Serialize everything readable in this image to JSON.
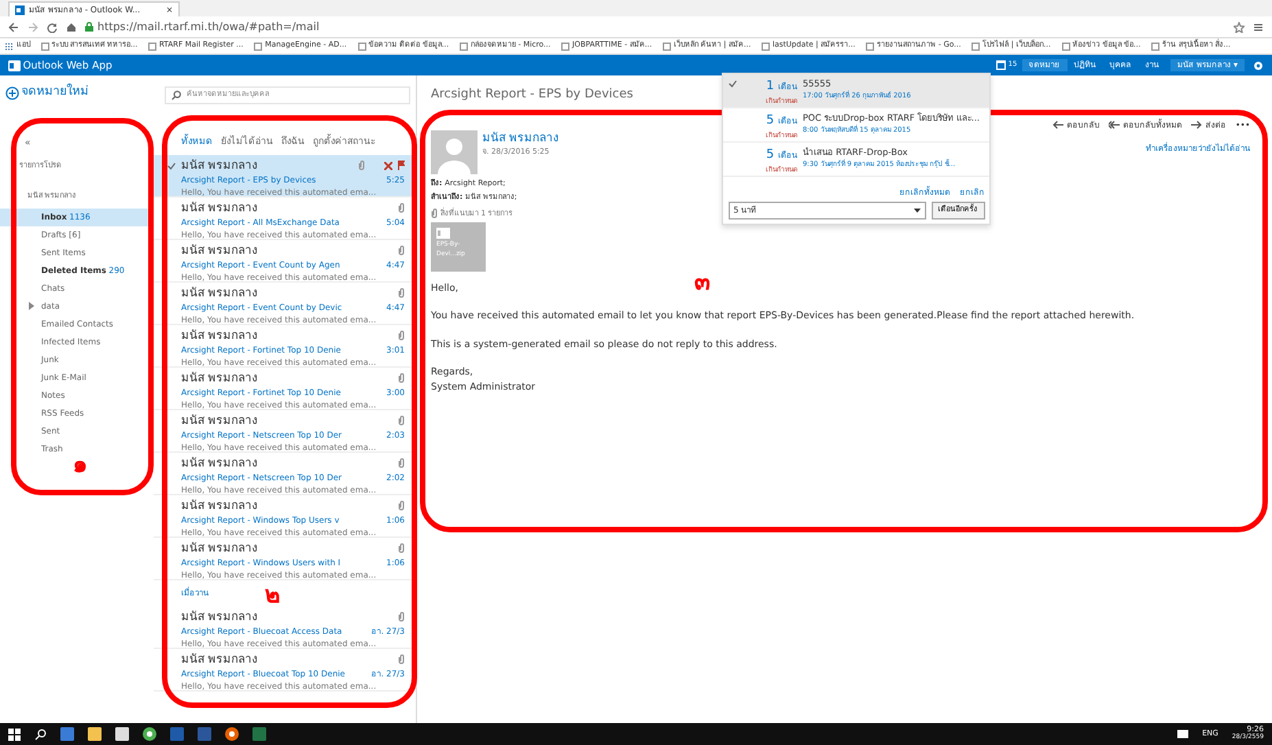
{
  "browser": {
    "tab_title": "มนัส พรมกลาง - Outlook W...",
    "tab_close": "×",
    "url": "https://mail.rtarf.mi.th/owa/#path=/mail",
    "bookmarks": [
      "แอป",
      "ระบบ สารสนเทศ ทหารอ...",
      "RTARF Mail Register ...",
      "ManageEngine - AD...",
      "ข้อความ ติดต่อ ข้อมูล...",
      "กล่องจดหมาย - Micro...",
      "JOBPARTTIME - สมัค...",
      "เว็บหลัก ค้นหา | สมัค...",
      "lastUpdate | สมัครรา...",
      "รายงานสถานภาพ - Go...",
      "โปรไฟล์ | เว็บบล็อก...",
      "ห้องข่าว ข้อมูล ข้อ...",
      "ร้าน สรุปเนื้อหา สั่ง..."
    ]
  },
  "app": {
    "title": "Outlook Web App",
    "nav": [
      {
        "label": "จดหมาย",
        "selected": true
      },
      {
        "label": "ปฏิทิน",
        "selected": false
      },
      {
        "label": "บุคคล",
        "selected": false
      },
      {
        "label": "งาน",
        "selected": false
      }
    ],
    "user": "มนัส พรมกลาง ▾",
    "badge": "15"
  },
  "folders": {
    "new_mail": "จดหมายใหม่",
    "collapse": "«",
    "favorites": "รายการโปรด",
    "account": "มนัส พรมกลาง",
    "items": [
      {
        "name": "Inbox",
        "count": "1136",
        "selected": true,
        "bold": true
      },
      {
        "name": "Drafts [6]",
        "selected": false,
        "bold": false
      },
      {
        "name": "Sent Items",
        "selected": false,
        "bold": false
      },
      {
        "name": "Deleted Items",
        "count": "290",
        "selected": false,
        "bold": true
      },
      {
        "name": "Chats",
        "selected": false,
        "bold": false
      },
      {
        "name": "data",
        "selected": false,
        "bold": false,
        "expandable": true
      },
      {
        "name": "Emailed Contacts",
        "selected": false,
        "bold": false
      },
      {
        "name": "Infected Items",
        "selected": false,
        "bold": false
      },
      {
        "name": "Junk",
        "selected": false,
        "bold": false
      },
      {
        "name": "Junk E-Mail",
        "selected": false,
        "bold": false
      },
      {
        "name": "Notes",
        "selected": false,
        "bold": false
      },
      {
        "name": "RSS Feeds",
        "selected": false,
        "bold": false
      },
      {
        "name": "Sent",
        "selected": false,
        "bold": false
      },
      {
        "name": "Trash",
        "selected": false,
        "bold": false
      }
    ]
  },
  "message_list": {
    "search_placeholder": "ค้นหาจดหมายและบุคคล",
    "filters": [
      {
        "label": "ทั้งหมด",
        "selected": true
      },
      {
        "label": "ยังไม่ได้อ่าน",
        "selected": false
      },
      {
        "label": "ถึงฉัน",
        "selected": false
      },
      {
        "label": "ถูกตั้งค่าสถานะ",
        "selected": false
      }
    ],
    "messages": [
      {
        "kind": "message",
        "sender": "มนัส พรมกลาง",
        "subject": "Arcsight Report - EPS by Devices",
        "preview": "Hello,  You have received this automated ema...",
        "time": "5:25",
        "selected": true
      },
      {
        "kind": "message",
        "sender": "มนัส พรมกลาง",
        "subject": "Arcsight Report - All MsExchange Data",
        "preview": "Hello,  You have received this automated ema...",
        "time": "5:04",
        "selected": false
      },
      {
        "kind": "message",
        "sender": "มนัส พรมกลาง",
        "subject": "Arcsight Report - Event Count by Agen",
        "preview": "Hello,  You have received this automated ema...",
        "time": "4:47",
        "selected": false
      },
      {
        "kind": "message",
        "sender": "มนัส พรมกลาง",
        "subject": "Arcsight Report - Event Count by Devic",
        "preview": "Hello,  You have received this automated ema...",
        "time": "4:47",
        "selected": false
      },
      {
        "kind": "message",
        "sender": "มนัส พรมกลาง",
        "subject": "Arcsight Report - Fortinet Top 10 Denie",
        "preview": "Hello,  You have received this automated ema...",
        "time": "3:01",
        "selected": false
      },
      {
        "kind": "message",
        "sender": "มนัส พรมกลาง",
        "subject": "Arcsight Report - Fortinet Top 10 Denie",
        "preview": "Hello,  You have received this automated ema...",
        "time": "3:00",
        "selected": false
      },
      {
        "kind": "message",
        "sender": "มนัส พรมกลาง",
        "subject": "Arcsight Report - Netscreen Top 10 Der",
        "preview": "Hello,  You have received this automated ema...",
        "time": "2:03",
        "selected": false
      },
      {
        "kind": "message",
        "sender": "มนัส พรมกลาง",
        "subject": "Arcsight Report - Netscreen Top 10 Der",
        "preview": "Hello,  You have received this automated ema...",
        "time": "2:02",
        "selected": false
      },
      {
        "kind": "message",
        "sender": "มนัส พรมกลาง",
        "subject": "Arcsight Report - Windows Top Users v",
        "preview": "Hello,  You have received this automated ema...",
        "time": "1:06",
        "selected": false
      },
      {
        "kind": "message",
        "sender": "มนัส พรมกลาง",
        "subject": "Arcsight Report - Windows Users with I",
        "preview": "Hello,  You have received this automated ema...",
        "time": "1:06",
        "selected": false
      },
      {
        "kind": "group",
        "label": "เมื่อวาน"
      },
      {
        "kind": "message",
        "sender": "มนัส พรมกลาง",
        "subject": "Arcsight Report - Bluecoat Access Data",
        "preview": "Hello,  You have received this automated ema...",
        "time": "อา. 27/3",
        "selected": false
      },
      {
        "kind": "message",
        "sender": "มนัส พรมกลาง",
        "subject": "Arcsight Report - Bluecoat Top 10 Denie",
        "preview": "Hello,  You have received this automated ema...",
        "time": "อา. 27/3",
        "selected": false
      }
    ]
  },
  "reading": {
    "subject": "Arcsight Report - EPS by Devices",
    "actions": [
      "ตอบกลับ",
      "ตอบกลับทั้งหมด",
      "ส่งต่อ",
      "•••"
    ],
    "mark_unread": "ทำเครื่องหมายว่ายังไม่ได้อ่าน",
    "sender": "มนัส พรมกลาง",
    "date": "จ. 28/3/2016 5:25",
    "to_label": "ถึง:",
    "to": "Arcsight Report;",
    "cc_label": "สำเนาถึง:",
    "cc": "มนัส พรมกลาง;",
    "attachments_label": "สิ่งที่แนบมา 1 รายการ",
    "attachment": "EPS-By-Devi...zip",
    "body": [
      "Hello,",
      "You have received this automated email to let you know that report EPS-By-Devices has been generated.Please find the report attached herewith.",
      "This is a system-generated email so please do not reply to this address.",
      "Regards,\nSystem Administrator"
    ]
  },
  "reminders": {
    "items": [
      {
        "due": "1",
        "unit": "เดือน",
        "status": "เกินกำหนด",
        "title": "55555",
        "when": "17:00 วันศุกร์ที่ 26 กุมภาพันธ์ 2016",
        "selected": true
      },
      {
        "due": "5",
        "unit": "เดือน",
        "status": "เกินกำหนด",
        "title": "POC ระบบDrop-box RTARF โดยบริษัท และ...",
        "when": "8:00 วันพฤหัสบดีที่ 15 ตุลาคม 2015",
        "selected": false
      },
      {
        "due": "5",
        "unit": "เดือน",
        "status": "เกินกำหนด",
        "title": "นำเสนอ RTARF-Drop-Box",
        "when": "9:30 วันศุกร์ที่ 9 ตุลาคม 2015 ห้องประชุม กรุ๊ป ชั้...",
        "selected": false
      }
    ],
    "dismiss_all": "ยกเลิกทั้งหมด",
    "dismiss": "ยกเลิก",
    "snooze_value": "5 นาที",
    "snooze": "เตือนอีกครั้ง"
  },
  "annotations": [
    "๑",
    "๒",
    "๓"
  ],
  "taskbar": {
    "language": "ENG",
    "time": "9:26",
    "date": "28/3/2559"
  }
}
